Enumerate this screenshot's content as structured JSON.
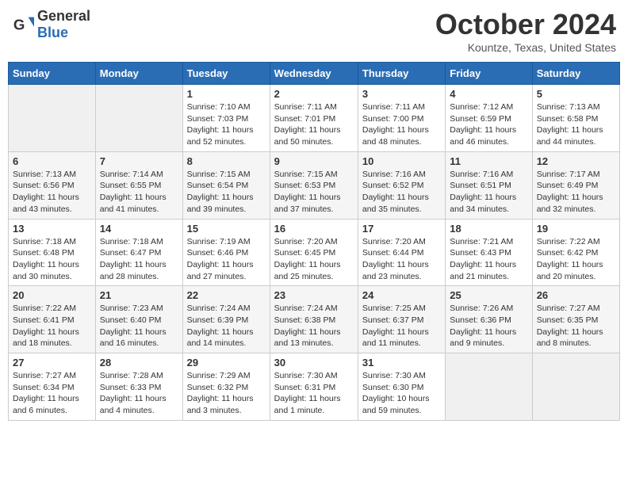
{
  "header": {
    "logo_general": "General",
    "logo_blue": "Blue",
    "title": "October 2024",
    "location": "Kountze, Texas, United States"
  },
  "days_of_week": [
    "Sunday",
    "Monday",
    "Tuesday",
    "Wednesday",
    "Thursday",
    "Friday",
    "Saturday"
  ],
  "weeks": [
    [
      {
        "day": "",
        "info": ""
      },
      {
        "day": "",
        "info": ""
      },
      {
        "day": "1",
        "info": "Sunrise: 7:10 AM\nSunset: 7:03 PM\nDaylight: 11 hours\nand 52 minutes."
      },
      {
        "day": "2",
        "info": "Sunrise: 7:11 AM\nSunset: 7:01 PM\nDaylight: 11 hours\nand 50 minutes."
      },
      {
        "day": "3",
        "info": "Sunrise: 7:11 AM\nSunset: 7:00 PM\nDaylight: 11 hours\nand 48 minutes."
      },
      {
        "day": "4",
        "info": "Sunrise: 7:12 AM\nSunset: 6:59 PM\nDaylight: 11 hours\nand 46 minutes."
      },
      {
        "day": "5",
        "info": "Sunrise: 7:13 AM\nSunset: 6:58 PM\nDaylight: 11 hours\nand 44 minutes."
      }
    ],
    [
      {
        "day": "6",
        "info": "Sunrise: 7:13 AM\nSunset: 6:56 PM\nDaylight: 11 hours\nand 43 minutes."
      },
      {
        "day": "7",
        "info": "Sunrise: 7:14 AM\nSunset: 6:55 PM\nDaylight: 11 hours\nand 41 minutes."
      },
      {
        "day": "8",
        "info": "Sunrise: 7:15 AM\nSunset: 6:54 PM\nDaylight: 11 hours\nand 39 minutes."
      },
      {
        "day": "9",
        "info": "Sunrise: 7:15 AM\nSunset: 6:53 PM\nDaylight: 11 hours\nand 37 minutes."
      },
      {
        "day": "10",
        "info": "Sunrise: 7:16 AM\nSunset: 6:52 PM\nDaylight: 11 hours\nand 35 minutes."
      },
      {
        "day": "11",
        "info": "Sunrise: 7:16 AM\nSunset: 6:51 PM\nDaylight: 11 hours\nand 34 minutes."
      },
      {
        "day": "12",
        "info": "Sunrise: 7:17 AM\nSunset: 6:49 PM\nDaylight: 11 hours\nand 32 minutes."
      }
    ],
    [
      {
        "day": "13",
        "info": "Sunrise: 7:18 AM\nSunset: 6:48 PM\nDaylight: 11 hours\nand 30 minutes."
      },
      {
        "day": "14",
        "info": "Sunrise: 7:18 AM\nSunset: 6:47 PM\nDaylight: 11 hours\nand 28 minutes."
      },
      {
        "day": "15",
        "info": "Sunrise: 7:19 AM\nSunset: 6:46 PM\nDaylight: 11 hours\nand 27 minutes."
      },
      {
        "day": "16",
        "info": "Sunrise: 7:20 AM\nSunset: 6:45 PM\nDaylight: 11 hours\nand 25 minutes."
      },
      {
        "day": "17",
        "info": "Sunrise: 7:20 AM\nSunset: 6:44 PM\nDaylight: 11 hours\nand 23 minutes."
      },
      {
        "day": "18",
        "info": "Sunrise: 7:21 AM\nSunset: 6:43 PM\nDaylight: 11 hours\nand 21 minutes."
      },
      {
        "day": "19",
        "info": "Sunrise: 7:22 AM\nSunset: 6:42 PM\nDaylight: 11 hours\nand 20 minutes."
      }
    ],
    [
      {
        "day": "20",
        "info": "Sunrise: 7:22 AM\nSunset: 6:41 PM\nDaylight: 11 hours\nand 18 minutes."
      },
      {
        "day": "21",
        "info": "Sunrise: 7:23 AM\nSunset: 6:40 PM\nDaylight: 11 hours\nand 16 minutes."
      },
      {
        "day": "22",
        "info": "Sunrise: 7:24 AM\nSunset: 6:39 PM\nDaylight: 11 hours\nand 14 minutes."
      },
      {
        "day": "23",
        "info": "Sunrise: 7:24 AM\nSunset: 6:38 PM\nDaylight: 11 hours\nand 13 minutes."
      },
      {
        "day": "24",
        "info": "Sunrise: 7:25 AM\nSunset: 6:37 PM\nDaylight: 11 hours\nand 11 minutes."
      },
      {
        "day": "25",
        "info": "Sunrise: 7:26 AM\nSunset: 6:36 PM\nDaylight: 11 hours\nand 9 minutes."
      },
      {
        "day": "26",
        "info": "Sunrise: 7:27 AM\nSunset: 6:35 PM\nDaylight: 11 hours\nand 8 minutes."
      }
    ],
    [
      {
        "day": "27",
        "info": "Sunrise: 7:27 AM\nSunset: 6:34 PM\nDaylight: 11 hours\nand 6 minutes."
      },
      {
        "day": "28",
        "info": "Sunrise: 7:28 AM\nSunset: 6:33 PM\nDaylight: 11 hours\nand 4 minutes."
      },
      {
        "day": "29",
        "info": "Sunrise: 7:29 AM\nSunset: 6:32 PM\nDaylight: 11 hours\nand 3 minutes."
      },
      {
        "day": "30",
        "info": "Sunrise: 7:30 AM\nSunset: 6:31 PM\nDaylight: 11 hours\nand 1 minute."
      },
      {
        "day": "31",
        "info": "Sunrise: 7:30 AM\nSunset: 6:30 PM\nDaylight: 10 hours\nand 59 minutes."
      },
      {
        "day": "",
        "info": ""
      },
      {
        "day": "",
        "info": ""
      }
    ]
  ]
}
